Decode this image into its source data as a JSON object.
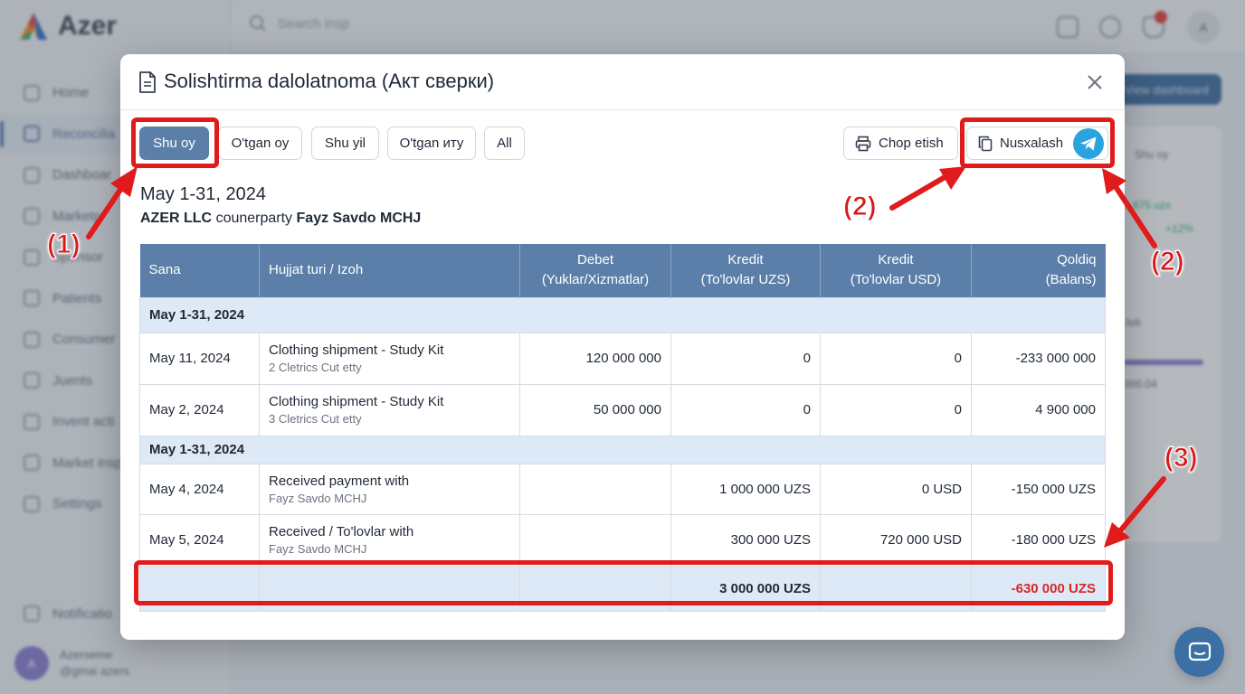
{
  "app": {
    "brand": "Azer",
    "search_placeholder": "Search insp",
    "sidebar": [
      "Home",
      "Reconcilia",
      "Dashboar",
      "Marketp",
      "Sponsor",
      "Patients",
      "Consumer",
      "Juents",
      "Invent acti",
      "Market insp",
      "Settings"
    ],
    "notifications": "Notificatio",
    "user_name": "Azerseme",
    "user_email": "@gmai azers",
    "user_initial": "A",
    "top_avatar": "A",
    "bg_button": "View dashboard",
    "bg_card": {
      "period": "Shu oy",
      "stat": "1 875 uzs",
      "pct": "+12%",
      "tag": "Jeti",
      "amount": "000.04"
    }
  },
  "modal": {
    "title": "Solishtirma dalolatnoma (Акт сверки)",
    "filters": [
      "Shu oy",
      "O'tgan oy",
      "Shu yil",
      "O'tgan иту",
      "All"
    ],
    "print_label": "Chop etish",
    "copy_label": "Nusxalash",
    "period": "May 1-31, 2024",
    "company": "AZER LLC",
    "counterparty_word": "counerparty",
    "counterparty": "Fayz Savdo MCHJ"
  },
  "table": {
    "headers": [
      {
        "line1": "Sana",
        "line2": ""
      },
      {
        "line1": "Hujjat turi / Izoh",
        "line2": ""
      },
      {
        "line1": "Debet",
        "line2": "(Yuklar/Xizmatlar)"
      },
      {
        "line1": "Kredit",
        "line2": "(To'lovlar UZS)"
      },
      {
        "line1": "Kredit",
        "line2": "(To'lovlar USD)"
      },
      {
        "line1": "Qoldiq",
        "line2": "(Balans)"
      }
    ],
    "groups": [
      {
        "title": "May 1-31, 2024",
        "rows": [
          {
            "date": "May 11, 2024",
            "doc": "Clothing shipment - Study Kit",
            "note": "2 Cletrics Cut etty",
            "debet": "120 000 000",
            "kredit_uzs": "0",
            "kredit_usd": "0",
            "balance": "-233 000 000"
          },
          {
            "date": "May 2, 2024",
            "doc": "Clothing shipment - Study Kit",
            "note": "3 Cletrics Cut etty",
            "debet": "50 000 000",
            "kredit_uzs": "0",
            "kredit_usd": "0",
            "balance": "4 900 000"
          }
        ]
      },
      {
        "title": "May 1-31, 2024",
        "rows": [
          {
            "date": "May 4, 2024",
            "doc": "Received payment with",
            "note": "Fayz Savdo MCHJ",
            "debet": "",
            "kredit_uzs": "1 000 000 UZS",
            "kredit_usd": "0 USD",
            "balance": "-150 000 UZS"
          },
          {
            "date": "May 5, 2024",
            "doc": "Received / To'lovlar with",
            "note": "Fayz Savdo MCHJ",
            "debet": "",
            "kredit_uzs": "300 000 UZS",
            "kredit_usd": "720 000 USD",
            "balance": "-180 000 UZS"
          }
        ]
      }
    ],
    "total": {
      "kredit_uzs": "3 000 000 UZS",
      "balance": "-630 000 UZS"
    }
  },
  "annotations": [
    "(1)",
    "(2)",
    "(2)",
    "(3)"
  ],
  "colors": {
    "primary": "#5b7fa8",
    "annotation": "#e01b1b",
    "negative": "#dc2626",
    "telegram": "#2aa3de"
  }
}
